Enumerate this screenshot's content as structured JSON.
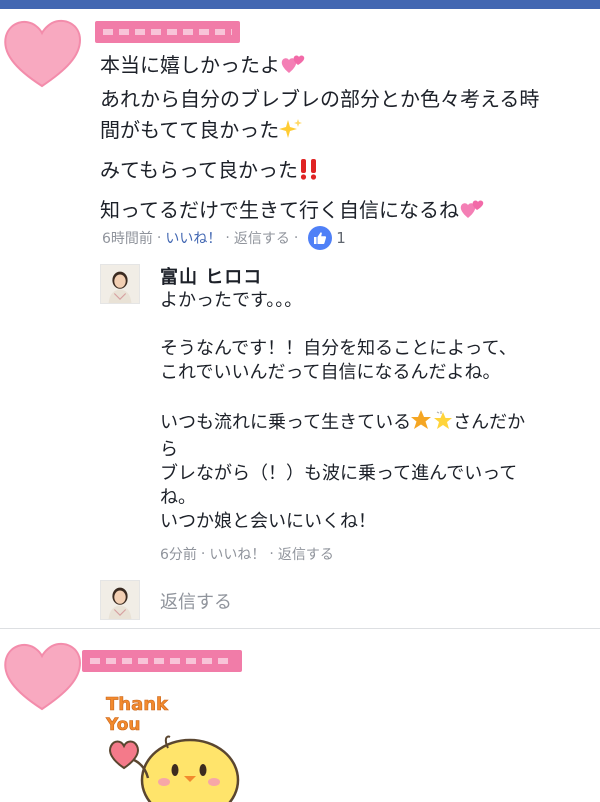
{
  "colors": {
    "top_bar": "#4267b2",
    "link_blue": "#4267b2",
    "meta_gray": "#90949c",
    "heart_pink": "#f8a9c0",
    "mask_pink": "#f06e9f"
  },
  "comment1": {
    "lines": [
      "本当に嬉しかったよ",
      "あれから自分のブレブレの部分とか色々考える時",
      "間がもてて良かった",
      "みてもらって良かった",
      "知ってるだけで生きて行く自信になるね"
    ],
    "meta": {
      "time": "6時間前",
      "like_label": "いいね！",
      "reply_label": "返信する",
      "like_count": "1"
    }
  },
  "reply": {
    "author": "富山 ヒロコ",
    "lines": [
      "よかったです。。。",
      "",
      "そうなんです！！自分を知ることによって、",
      "これでいいんだって自信になるんだよね。",
      "",
      "いつも流れに乗って生きている",
      "ら",
      "ブレながら（！）も波に乗って進んでいって",
      "ね。",
      "いつか娘と会いにいくね！"
    ],
    "line6_suffix": "さんだか",
    "meta": {
      "time": "6分前",
      "like_label": "いいね！",
      "reply_label": "返信する"
    }
  },
  "reply_input": {
    "placeholder": "返信する"
  },
  "sticker": {
    "text_line1": "Thank",
    "text_line2": "You"
  }
}
